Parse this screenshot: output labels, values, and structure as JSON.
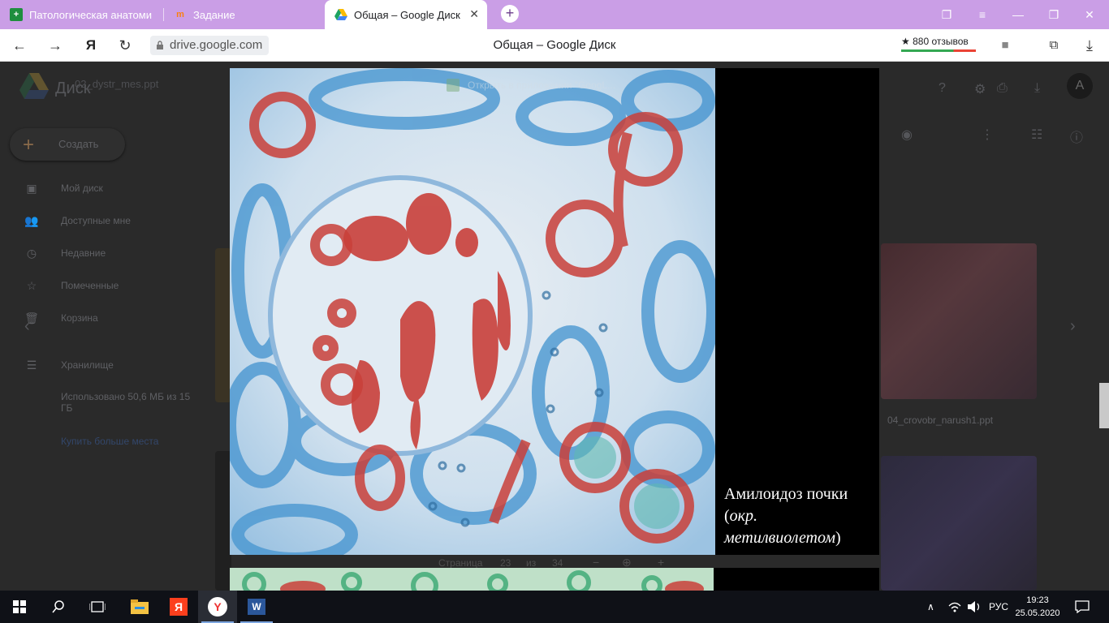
{
  "browser": {
    "tabs": [
      {
        "label": "Патологическая анатоми",
        "favicon": "sheets-icon",
        "active": false
      },
      {
        "label": "Задание",
        "favicon": "moodle-icon",
        "active": false
      },
      {
        "label": "Общая – Google Диск",
        "favicon": "google-drive-icon",
        "active": true
      }
    ],
    "url": "drive.google.com",
    "page_title": "Общая – Google Диск",
    "reviews": "★ 880 отзывов"
  },
  "drive": {
    "app_name": "Диск",
    "file_name": "02_dystr_mes.ppt",
    "create_label": "Создать",
    "sidebar": [
      {
        "label": "Мой диск",
        "icon": "my-drive-icon"
      },
      {
        "label": "Доступные мне",
        "icon": "shared-icon"
      },
      {
        "label": "Недавние",
        "icon": "recent-icon"
      },
      {
        "label": "Помеченные",
        "icon": "star-icon"
      },
      {
        "label": "Корзина",
        "icon": "trash-icon"
      }
    ],
    "storage_label": "Хранилище",
    "storage_used": "Использовано 50,6 МБ из 15 ГБ",
    "buy_more": "Купить больше места",
    "grid_file_name": "04_crovobr_narush1.ppt",
    "open_with": "Открыть в приложении \"GoogL..."
  },
  "viewer": {
    "caption_title": "Амилоидоз почки",
    "caption_paren_open": "(",
    "caption_italic": "окр. метилвиолетом",
    "caption_paren_close": ")",
    "pager_label": "Страница",
    "current_page": "23",
    "of_label": "из",
    "total_pages": "34"
  },
  "taskbar": {
    "language": "РУС",
    "time": "19:23",
    "date": "25.05.2020"
  }
}
